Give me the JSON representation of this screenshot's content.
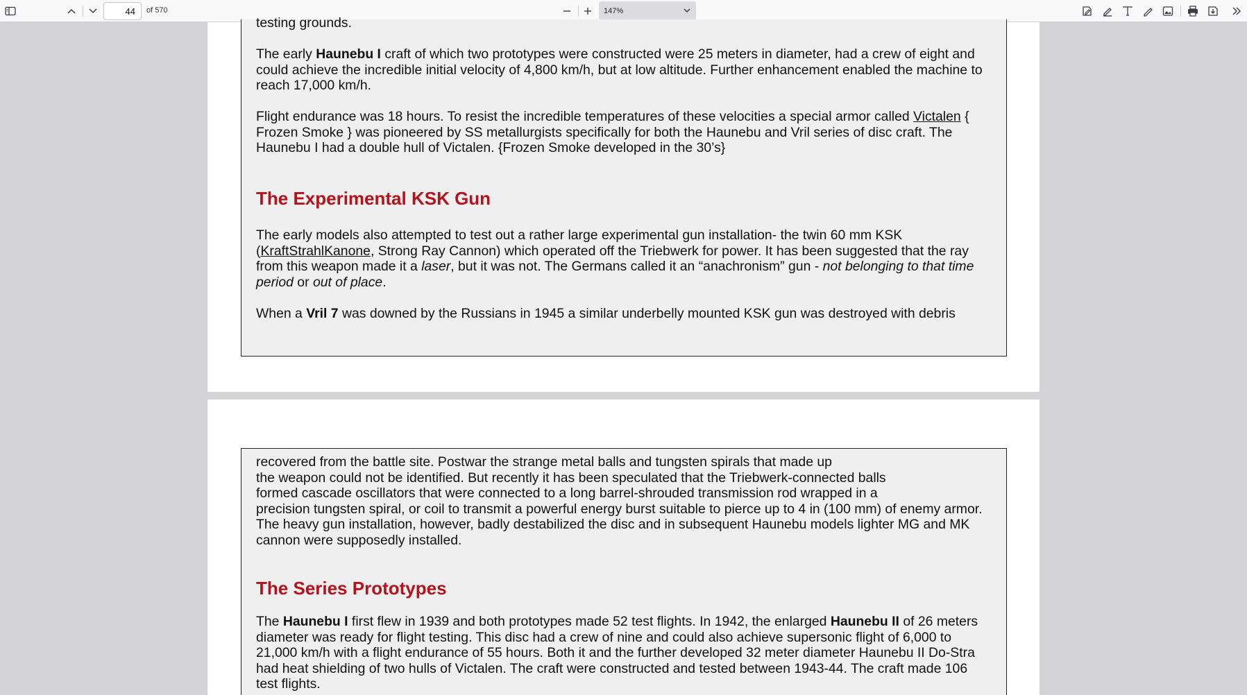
{
  "toolbar": {
    "page_number": "44",
    "page_count_label": "of 570",
    "zoom": "147%",
    "icons": [
      "sidebar-toggle-icon",
      "previous-page-icon",
      "next-page-icon",
      "zoom-out-icon",
      "zoom-in-icon",
      "chevron-down-icon",
      "sign-icon",
      "highlight-icon",
      "text-icon",
      "draw-icon",
      "image-icon",
      "print-icon",
      "save-icon",
      "more-tools-icon"
    ]
  },
  "page1": {
    "top_fragment": "testing grounds.",
    "para1": {
      "l1_a": "The early ",
      "l1_b": "Haunebu I",
      "l1_c": " craft of which two prototypes were constructed were 25 meters in diameter, had a crew of eight and",
      "l2": "could achieve the incredible initial velocity of 4,800 km/h, but at low altitude. Further enhancement enabled the machine to",
      "l3": "reach 17,000 km/h."
    },
    "para2": {
      "l1_a": "Flight endurance was 18 hours. To resist the incredible temperatures of these velocities a special armor called ",
      "l1_link": "Victalen",
      "l1_b": " {",
      "l2": "Frozen Smoke } was pioneered by SS metallurgists specifically for both the Haunebu and Vril series of disc craft. The",
      "l3": "Haunebu I had a double hull of Victalen. {Frozen Smoke developed in the 30’s}"
    },
    "heading": "The Experimental KSK Gun",
    "para3": {
      "l1": "The early models also attempted to test out a rather large experimental gun installation- the twin 60 mm KSK",
      "l2_a": "(",
      "l2_link": "KraftStrahlKanone",
      "l2_b": ", Strong Ray Cannon) which operated off the Triebwerk for power. It has been suggested that the ray",
      "l3_a": "from this weapon made it a ",
      "l3_i": "laser",
      "l3_b": ", but it was not. The Germans called it an “anachronism” gun - ",
      "l3_i2": "not belonging to that time",
      "l4_i": "period",
      "l4_a": " or ",
      "l4_i2": "out of place",
      "l4_b": "."
    },
    "para4": {
      "l1_a": "When a ",
      "l1_b": "Vril 7",
      "l1_c": " was downed by the Russians in 1945 a similar underbelly mounted KSK gun was destroyed with debris"
    }
  },
  "page2": {
    "para1": {
      "l1": "recovered from the battle site. Postwar the strange metal balls and tungsten spirals that made up",
      "l2": "the weapon could not be identified. But recently it has been speculated that the Triebwerk-connected balls",
      "l3": "formed cascade oscillators that were connected to a long barrel-shrouded transmission rod wrapped in a",
      "l4": "precision tungsten spiral, or coil to transmit a powerful energy burst suitable to pierce up to 4 in (100 mm) of enemy armor.",
      "l5": "The heavy gun installation, however, badly destabilized the disc and in subsequent Haunebu models lighter MG and MK",
      "l6": "cannon were supposedly installed."
    },
    "heading": "The Series Prototypes",
    "para2": {
      "l1_a": "The ",
      "l1_b": "Haunebu I",
      "l1_c": " first flew in 1939 and both prototypes made 52 test flights. In 1942, the enlarged ",
      "l1_d": "Haunebu II",
      "l1_e": " of 26 meters",
      "l2": "diameter was ready for flight testing. This disc had a crew of nine and could also achieve supersonic flight of 6,000 to",
      "l3": "21,000 km/h with a flight endurance of 55 hours. Both it and the further developed 32 meter diameter Haunebu II Do-Stra",
      "l4": "had heat shielding of two hulls of Victalen. The craft were constructed and tested between 1943-44. The craft made 106",
      "l5": "test flights."
    }
  }
}
